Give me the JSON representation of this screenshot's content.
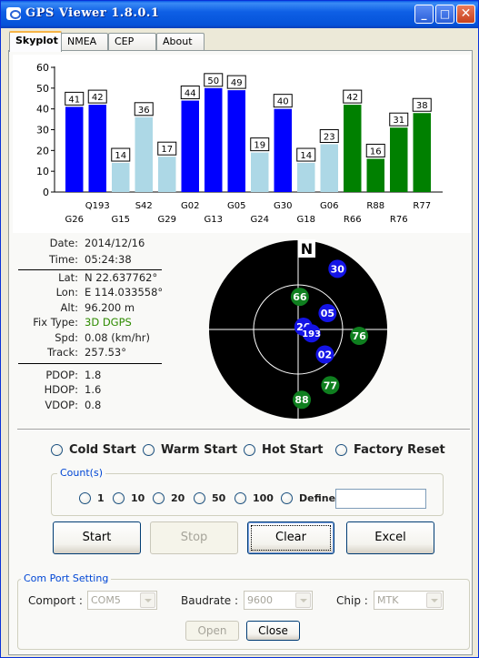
{
  "window": {
    "title": "GPS Viewer 1.8.0.1",
    "min_label": "_",
    "max_label": "□",
    "close_label": "✕"
  },
  "tabs": [
    {
      "label": "Skyplot",
      "active": true
    },
    {
      "label": "NMEA",
      "active": false
    },
    {
      "label": "CEP",
      "active": false
    },
    {
      "label": "About",
      "active": false
    }
  ],
  "chart_data": {
    "type": "bar",
    "ylim": [
      0,
      60
    ],
    "yticks": [
      0,
      10,
      20,
      30,
      40,
      50,
      60
    ],
    "grid": false,
    "categories": [
      "G26",
      "Q193",
      "G15",
      "S42",
      "G29",
      "G02",
      "G13",
      "G05",
      "G24",
      "G30",
      "G18",
      "G06",
      "R66",
      "R88",
      "R76",
      "R77"
    ],
    "values": [
      41,
      42,
      14,
      36,
      17,
      44,
      50,
      49,
      19,
      40,
      14,
      23,
      42,
      16,
      31,
      38
    ],
    "bar_colors": [
      "#0000FF",
      "#0000FF",
      "#ADD8E6",
      "#ADD8E6",
      "#ADD8E6",
      "#0000FF",
      "#0000FF",
      "#0000FF",
      "#ADD8E6",
      "#0000FF",
      "#ADD8E6",
      "#ADD8E6",
      "#008000",
      "#008000",
      "#008000",
      "#008000"
    ]
  },
  "info": {
    "date_label": "Date:",
    "date": "2014/12/16",
    "time_label": "Time:",
    "time": "05:24:38",
    "lat_label": "Lat:",
    "lat": "N 22.637762°",
    "lon_label": "Lon:",
    "lon": "E 114.033558°",
    "alt_label": "Alt:",
    "alt": "96.200 m",
    "fix_label": "Fix Type:",
    "fix": "3D DGPS",
    "fix_color": "#2E8B00",
    "spd_label": "Spd:",
    "spd": "0.08 (km/hr)",
    "track_label": "Track:",
    "track": "257.53°",
    "pdop_label": "PDOP:",
    "pdop": "1.8",
    "hdop_label": "HDOP:",
    "hdop": "1.6",
    "vdop_label": "VDOP:",
    "vdop": "0.8"
  },
  "skyplot": {
    "north_label": "N",
    "satellites": [
      {
        "id": "66",
        "az": 3,
        "el": 57,
        "color": "#0F7F1F"
      },
      {
        "id": "30",
        "az": 33,
        "el": 17,
        "color": "#1414E6"
      },
      {
        "id": "05",
        "az": 61,
        "el": 56,
        "color": "#1414E6"
      },
      {
        "id": "26",
        "az": 63,
        "el": 84,
        "color": "#1414E6"
      },
      {
        "id": "193",
        "az": 106,
        "el": 76,
        "color": "#1414E6"
      },
      {
        "id": "76",
        "az": 96,
        "el": 28,
        "color": "#0F7F1F"
      },
      {
        "id": "02",
        "az": 133,
        "el": 53,
        "color": "#1414E6"
      },
      {
        "id": "77",
        "az": 150,
        "el": 25,
        "color": "#0F7F1F"
      },
      {
        "id": "88",
        "az": 177,
        "el": 19,
        "color": "#0F7F1F"
      }
    ]
  },
  "start_modes": [
    "Cold Start",
    "Warm Start",
    "Hot Start",
    "Factory Reset"
  ],
  "counts": {
    "title": "Count(s)",
    "options": [
      "1",
      "10",
      "20",
      "50",
      "100",
      "Define"
    ],
    "define_value": ""
  },
  "buttons": {
    "start": "Start",
    "stop": "Stop",
    "clear": "Clear",
    "excel": "Excel"
  },
  "comport": {
    "title": "Com Port Setting",
    "comport_label": "Comport :",
    "comport_value": "COM5",
    "baud_label": "Baudrate :",
    "baud_value": "9600",
    "chip_label": "Chip :",
    "chip_value": "MTK",
    "open_label": "Open",
    "close_label": "Close"
  }
}
